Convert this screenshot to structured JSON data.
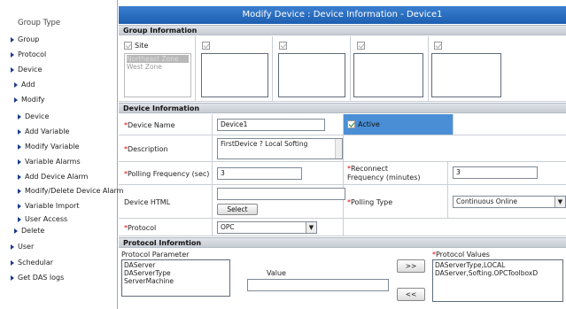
{
  "sidebar": {
    "title": "Group Type",
    "items": [
      {
        "label": "Group"
      },
      {
        "label": "Protocol"
      },
      {
        "label": "Device"
      },
      {
        "label": "Add"
      },
      {
        "label": "Modify"
      },
      {
        "label": "Device"
      },
      {
        "label": "Add Variable"
      },
      {
        "label": "Modify Variable"
      },
      {
        "label": "Variable Alarms"
      },
      {
        "label": "Add Device Alarm"
      },
      {
        "label": "Modify/Delete Device Alarm"
      },
      {
        "label": "Variable Import"
      },
      {
        "label": "User Access"
      },
      {
        "label": "Delete"
      },
      {
        "label": "User"
      },
      {
        "label": "Schedular"
      },
      {
        "label": "Get DAS logs"
      }
    ]
  },
  "header": {
    "title": "Modify Device : Device Information - Device1"
  },
  "group_info": {
    "section_title": "Group Information",
    "site_label": "Site",
    "site_list": [
      "Northeast Zone",
      "West Zone"
    ]
  },
  "device_info": {
    "section_title": "Device Information",
    "device_name_label": "Device Name",
    "device_name_value": "Device1",
    "active_label": "Active",
    "description_label": "Description",
    "description_value": "FirstDevice ? Local Softing",
    "polling_freq_label": "Polling Frequency (sec)",
    "polling_freq_value": "3",
    "reconnect_label_1": "Reconnect",
    "reconnect_label_2": "Frequency (minutes)",
    "reconnect_value": "3",
    "device_html_label": "Device HTML",
    "select_button": "Select",
    "polling_type_label": "Polling Type",
    "polling_type_value": "Continuous Online",
    "protocol_label": "Protocol",
    "protocol_value": "OPC",
    "required_mark": "*"
  },
  "protocol_info": {
    "section_title": "Protocol Informtion",
    "param_label": "Protocol Parameter",
    "params": [
      "DAServer",
      "DAServerType",
      "ServerMachine"
    ],
    "value_label": "Value",
    "add_button": ">>",
    "remove_button": "<<",
    "values_label": "Protocol Values",
    "values": [
      "DAServerType,LOCAL",
      "DAServer,Softing.OPCToolboxD"
    ]
  },
  "colors": {
    "header_bg": "#1d5fb0",
    "required": "#dd0000",
    "active_bg": "#4a8fd6"
  }
}
